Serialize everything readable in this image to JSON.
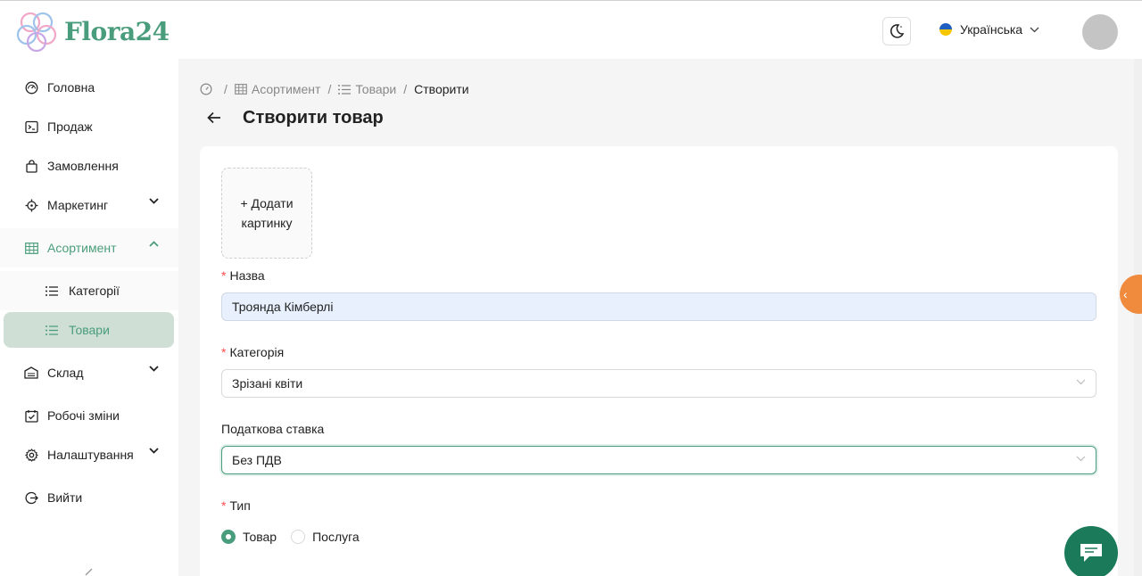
{
  "brand": {
    "name": "Flora24"
  },
  "header": {
    "language": "Українська"
  },
  "sidebar": {
    "items": [
      {
        "label": "Головна"
      },
      {
        "label": "Продаж"
      },
      {
        "label": "Замовлення"
      },
      {
        "label": "Маркетинг"
      },
      {
        "label": "Асортимент"
      },
      {
        "label": "Склад"
      },
      {
        "label": "Робочі зміни"
      },
      {
        "label": "Налаштування"
      },
      {
        "label": "Вийти"
      }
    ],
    "subitems": [
      {
        "label": "Категорії"
      },
      {
        "label": "Товари"
      }
    ]
  },
  "breadcrumb": {
    "c1": "Асортимент",
    "c2": "Товари",
    "c3": "Створити"
  },
  "page": {
    "title": "Створити товар"
  },
  "form": {
    "upload_line1": "+ Додати",
    "upload_line2": "картинку",
    "name_label": "Назва",
    "name_value": "Троянда Кімберлі",
    "category_label": "Категорія",
    "category_value": "Зрізані квіти",
    "tax_label": "Податкова ставка",
    "tax_value": "Без ПДВ",
    "type_label": "Тип",
    "type_options": [
      "Товар",
      "Послуга"
    ],
    "type_selected": "Товар"
  },
  "colors": {
    "accent": "#4a9d7c",
    "required": "#ff4d4f",
    "side_tab": "#f08a3c",
    "chat": "#1a7a5a"
  }
}
